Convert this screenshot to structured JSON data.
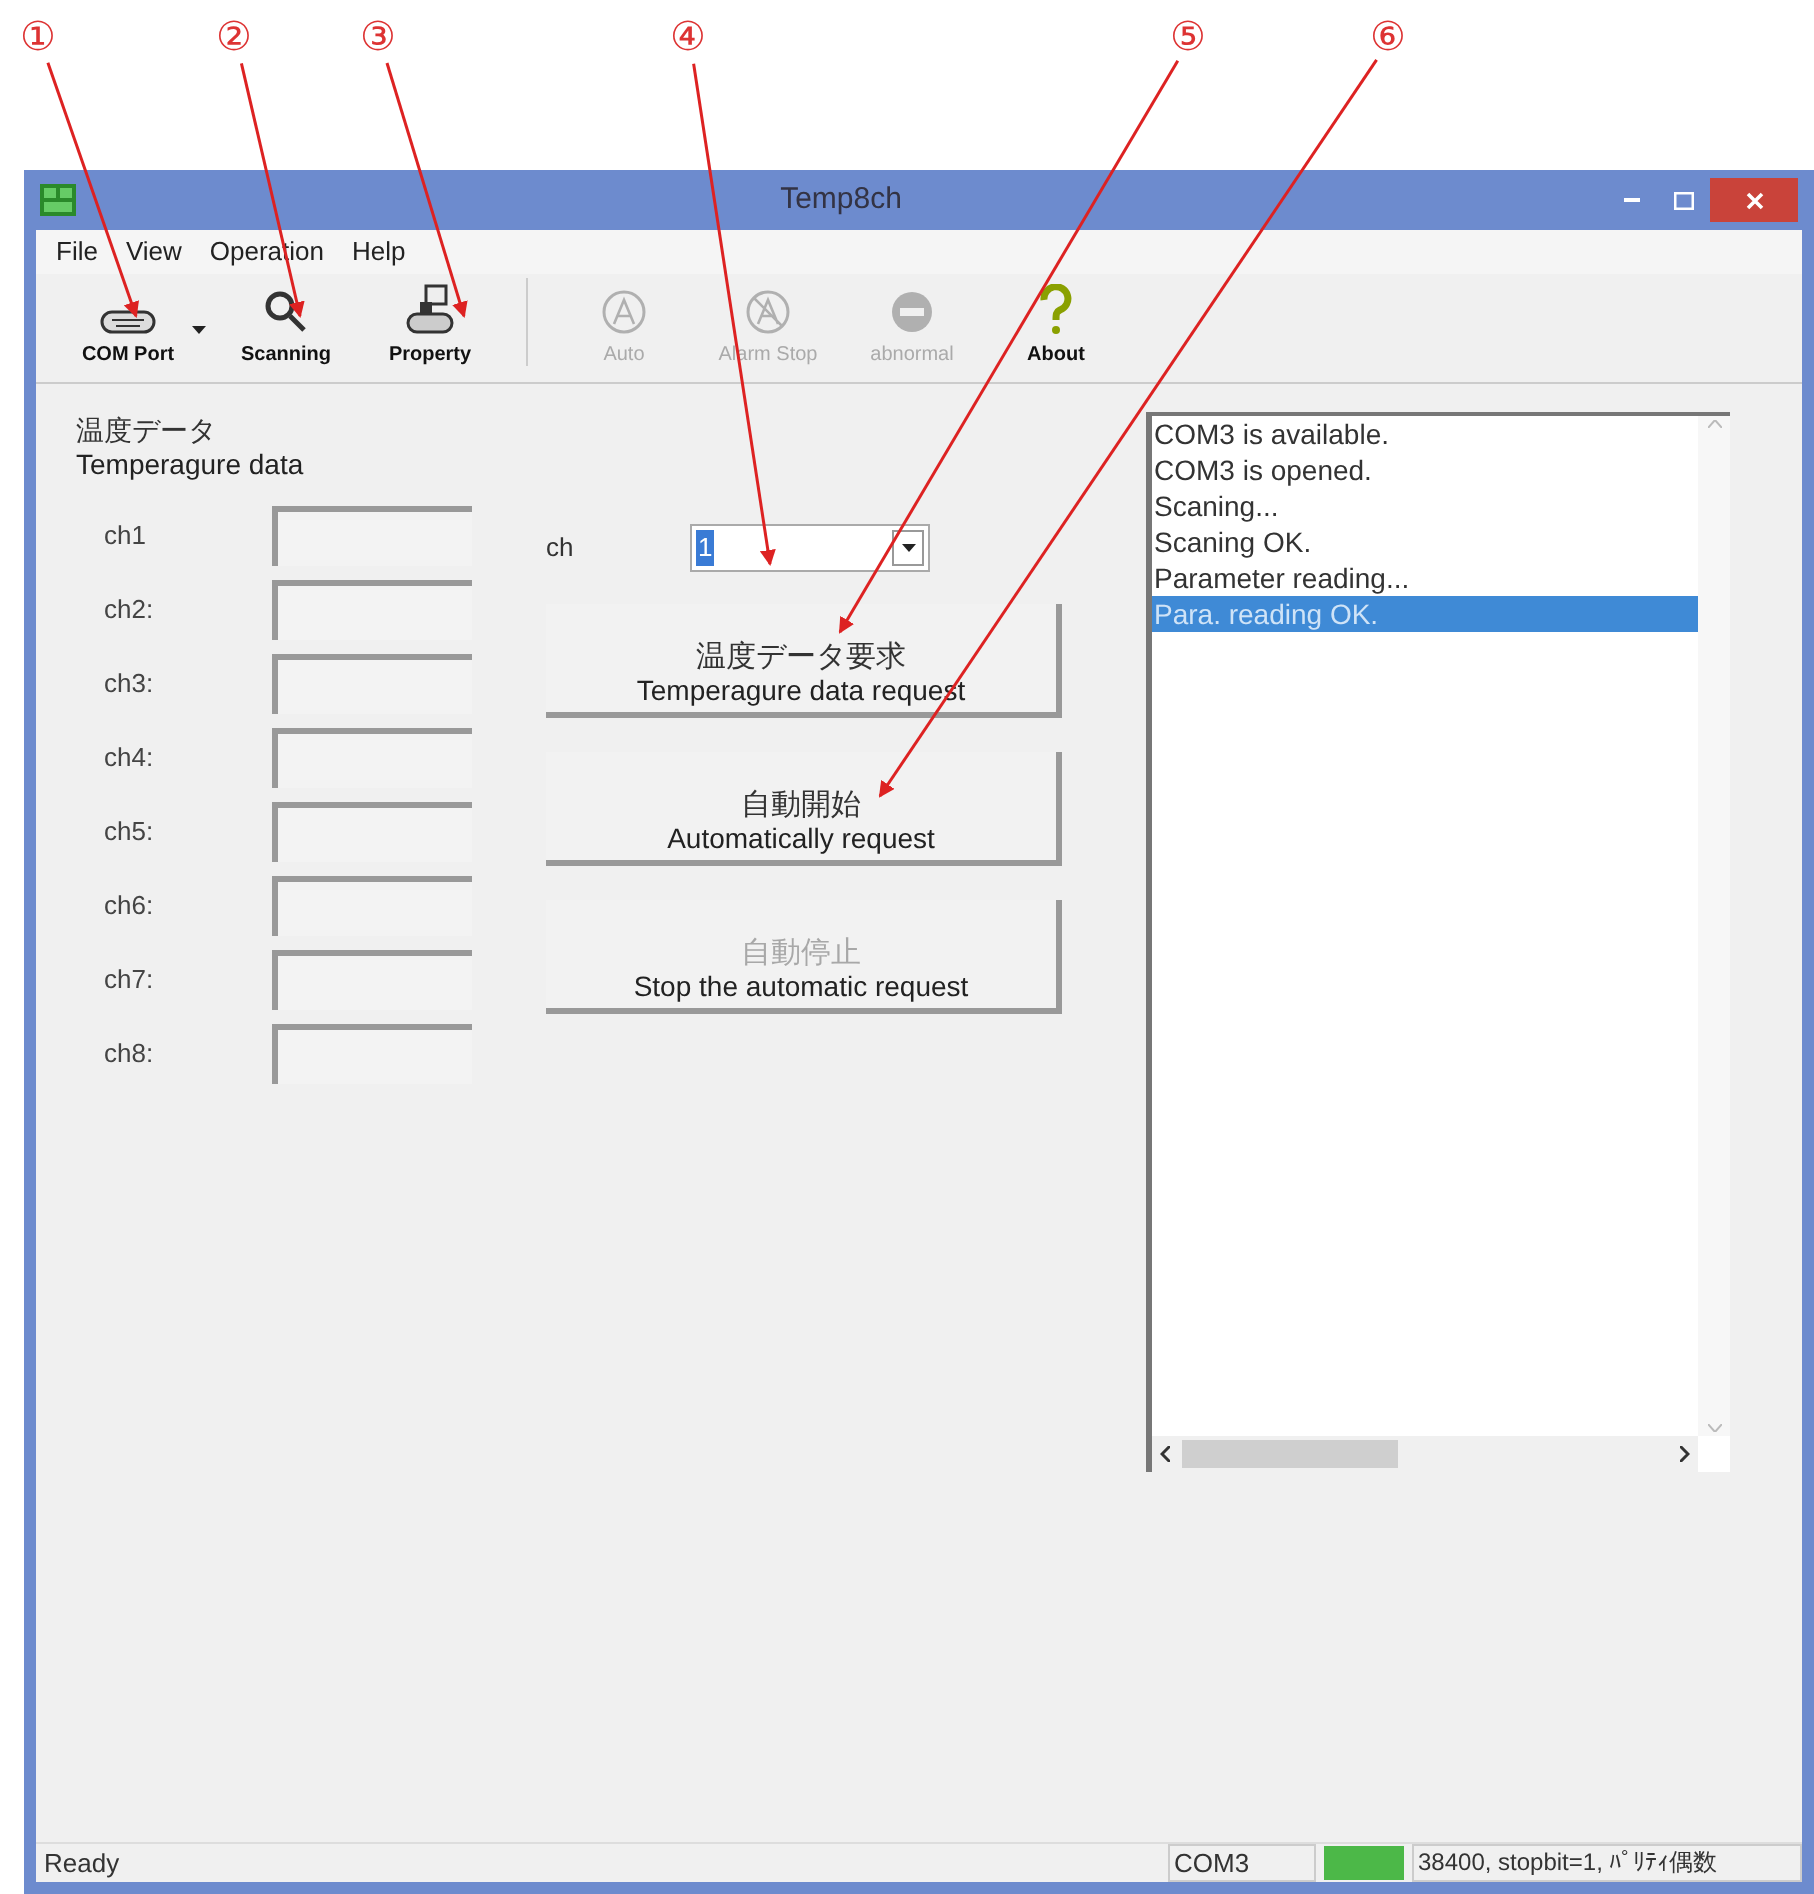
{
  "callouts": [
    {
      "label": "①"
    },
    {
      "label": "②"
    },
    {
      "label": "③"
    },
    {
      "label": "④"
    },
    {
      "label": "⑤"
    },
    {
      "label": "⑥"
    }
  ],
  "window": {
    "title": "Temp8ch"
  },
  "menu": [
    "File",
    "View",
    "Operation",
    "Help"
  ],
  "toolbar": [
    {
      "kind": "com",
      "label": "COM Port",
      "disabled": false,
      "dropdown": true
    },
    {
      "kind": "scan",
      "label": "Scanning",
      "disabled": false,
      "dropdown": false
    },
    {
      "kind": "property",
      "label": "Property",
      "disabled": false,
      "dropdown": false
    },
    {
      "kind": "separator"
    },
    {
      "kind": "auto",
      "label": "Auto",
      "disabled": true,
      "dropdown": false
    },
    {
      "kind": "alarm",
      "label": "Alarm Stop",
      "disabled": true,
      "dropdown": false
    },
    {
      "kind": "abnormal",
      "label": "abnormal",
      "disabled": true,
      "dropdown": false
    },
    {
      "kind": "about",
      "label": "About",
      "disabled": false,
      "dropdown": false
    }
  ],
  "group": {
    "title": "温度データ",
    "subtitle": "Temperagure data"
  },
  "channels": [
    {
      "label": "ch1"
    },
    {
      "label": "ch2:"
    },
    {
      "label": "ch3:"
    },
    {
      "label": "ch4:"
    },
    {
      "label": "ch5:"
    },
    {
      "label": "ch6:"
    },
    {
      "label": "ch7:"
    },
    {
      "label": "ch8:"
    }
  ],
  "ch_select": {
    "label": "ch",
    "value": "1"
  },
  "buttons": [
    {
      "label": "温度データ要求",
      "note": "Temperagure data request",
      "disabled": false
    },
    {
      "label": "自動開始",
      "note": "Automatically request",
      "disabled": false
    },
    {
      "label": "自動停止",
      "note": "Stop the automatic request",
      "disabled": true
    }
  ],
  "log": [
    {
      "text": "COM3 is available.",
      "selected": false
    },
    {
      "text": "COM3 is opened.",
      "selected": false
    },
    {
      "text": "Scaning...",
      "selected": false
    },
    {
      "text": "Scaning OK.",
      "selected": false
    },
    {
      "text": "Parameter reading...",
      "selected": false
    },
    {
      "text": "Para. reading OK.",
      "selected": true
    }
  ],
  "status_bar": {
    "text": "Ready",
    "port": "COM3",
    "settings": "38400, stopbit=1, ﾊﾟﾘﾃｨ偶数"
  }
}
